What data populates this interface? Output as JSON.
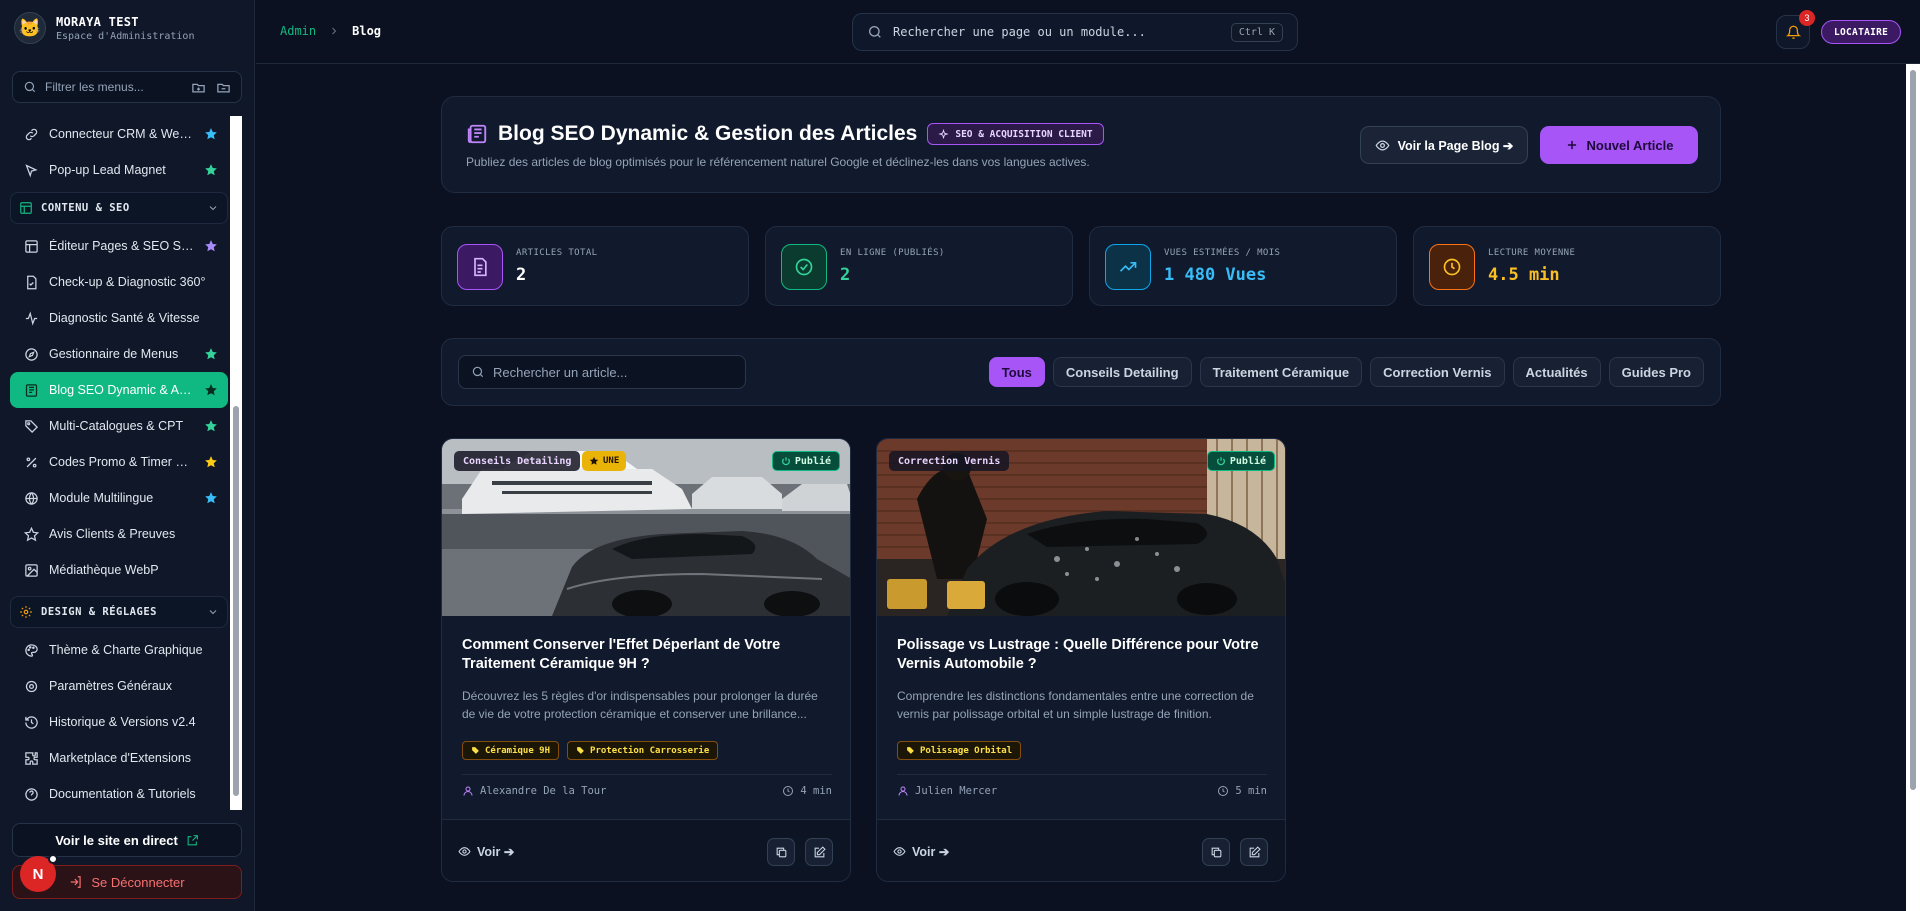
{
  "brand": {
    "title": "MORAYA TEST",
    "subtitle": "Espace d'Administration",
    "logo": "🐱"
  },
  "sidebar": {
    "filter_placeholder": "Filtrer les menus...",
    "items_top": [
      {
        "label": "Connecteur CRM & Webh...",
        "icon": "link-icon",
        "star": "#38bdf8"
      },
      {
        "label": "Pop-up Lead Magnet",
        "icon": "popup-icon",
        "star": "#34d399"
      }
    ],
    "section_content": "CONTENU & SEO",
    "items_content": [
      {
        "label": "Éditeur Pages & SEO Sur-...",
        "icon": "layout-icon",
        "star": "#a78bfa"
      },
      {
        "label": "Check-up & Diagnostic 360°",
        "icon": "file-check-icon",
        "star": ""
      },
      {
        "label": "Diagnostic Santé & Vitesse",
        "icon": "activity-icon",
        "star": ""
      },
      {
        "label": "Gestionnaire de Menus",
        "icon": "compass-icon",
        "star": "#34d399"
      },
      {
        "label": "Blog SEO Dynamic & Artic...",
        "icon": "newspaper-icon",
        "star": "#064e3b",
        "active": true
      },
      {
        "label": "Multi-Catalogues & CPT",
        "icon": "tag-icon",
        "star": "#34d399"
      },
      {
        "label": "Codes Promo & Timer Ur...",
        "icon": "percent-icon",
        "star": "#facc15"
      },
      {
        "label": "Module Multilingue",
        "icon": "globe-icon",
        "star": "#38bdf8"
      },
      {
        "label": "Avis Clients & Preuves",
        "icon": "star-outline-icon",
        "star": ""
      },
      {
        "label": "Médiathèque WebP",
        "icon": "image-icon",
        "star": ""
      }
    ],
    "section_design": "DESIGN & RÉGLAGES",
    "items_design": [
      {
        "label": "Thème & Charte Graphique",
        "icon": "palette-icon"
      },
      {
        "label": "Paramètres Généraux",
        "icon": "settings-icon"
      },
      {
        "label": "Historique & Versions v2.4",
        "icon": "history-icon"
      },
      {
        "label": "Marketplace d'Extensions",
        "icon": "puzzle-icon"
      },
      {
        "label": "Documentation & Tutoriels",
        "icon": "help-icon"
      }
    ],
    "live_site": "Voir le site en direct",
    "logout": "Se Déconnecter",
    "avatar_initial": "N"
  },
  "topbar": {
    "crumb_root": "Admin",
    "crumb_current": "Blog",
    "search_placeholder": "Rechercher une page ou un module...",
    "shortcut": "Ctrl K",
    "notifications": "3",
    "role": "LOCATAIRE"
  },
  "header": {
    "title": "Blog SEO Dynamic & Gestion des Articles",
    "badge": "SEO & ACQUISITION CLIENT",
    "subtitle": "Publiez des articles de blog optimisés pour le référencement naturel Google et déclinez-les dans vos langues actives.",
    "view_blog": "Voir la Page Blog ➔",
    "new_article": "Nouvel Article"
  },
  "stats": [
    {
      "label": "ARTICLES TOTAL",
      "value": "2",
      "color": "#ffffff",
      "accent": "#a855f7"
    },
    {
      "label": "EN LIGNE (PUBLIÉS)",
      "value": "2",
      "color": "#34d399",
      "accent": "#10b981"
    },
    {
      "label": "VUES ESTIMÉES / MOIS",
      "value": "1 480 Vues",
      "color": "#38bdf8",
      "accent": "#0ea5e9"
    },
    {
      "label": "LECTURE MOYENNE",
      "value": "4.5 min",
      "color": "#fbbf24",
      "accent": "#f97316"
    }
  ],
  "filters": {
    "search_placeholder": "Rechercher un article...",
    "chips": [
      "Tous",
      "Conseils Detailing",
      "Traitement Céramique",
      "Correction Vernis",
      "Actualités",
      "Guides Pro"
    ]
  },
  "articles": [
    {
      "category": "Conseils Detailing",
      "featured": "UNE",
      "status": "Publié",
      "title": "Comment Conserver l'Effet Déperlant de Votre Traitement Céramique 9H ?",
      "excerpt": "Découvrez les 5 règles d'or indispensables pour prolonger la durée de vie de votre protection céramique et conserver une brillance...",
      "tags": [
        "Céramique 9H",
        "Protection Carrosserie"
      ],
      "author": "Alexandre De la Tour",
      "read_time": "4 min",
      "view": "Voir ➔"
    },
    {
      "category": "Correction Vernis",
      "status": "Publié",
      "title": "Polissage vs Lustrage : Quelle Différence pour Votre Vernis Automobile ?",
      "excerpt": "Comprendre les distinctions fondamentales entre une correction de vernis par polissage orbital et un simple lustrage de finition.",
      "tags": [
        "Polissage Orbital"
      ],
      "author": "Julien Mercer",
      "read_time": "5 min",
      "view": "Voir ➔"
    }
  ]
}
